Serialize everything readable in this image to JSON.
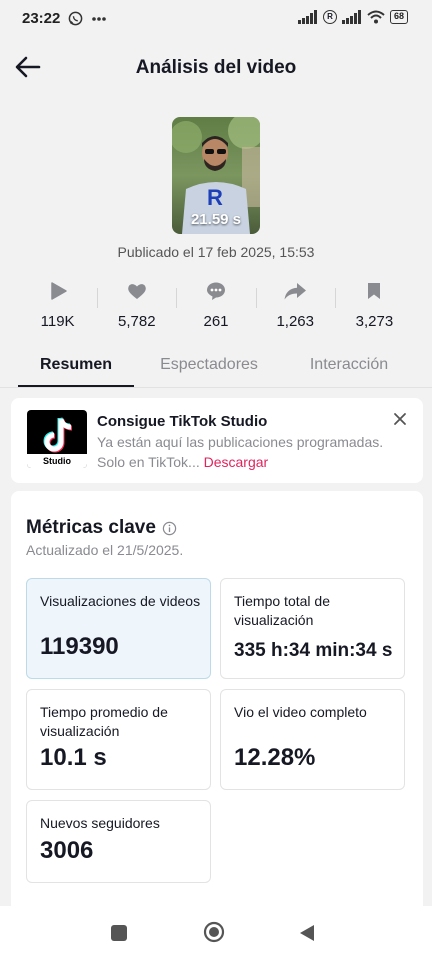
{
  "status_bar": {
    "time": "23:22",
    "battery": "68"
  },
  "header": {
    "title": "Análisis del video"
  },
  "video": {
    "duration": "21.59 s",
    "published": "Publicado el 17 feb 2025, 15:53"
  },
  "stats": [
    {
      "icon": "play-icon",
      "value": "119K"
    },
    {
      "icon": "heart-icon",
      "value": "5,782"
    },
    {
      "icon": "comment-icon",
      "value": "261"
    },
    {
      "icon": "share-icon",
      "value": "1,263"
    },
    {
      "icon": "bookmark-icon",
      "value": "3,273"
    }
  ],
  "tabs": {
    "resumen": "Resumen",
    "espectadores": "Espectadores",
    "interaccion": "Interacción",
    "active": "Resumen"
  },
  "promo": {
    "logo_label": "Studio",
    "title": "Consigue TikTok Studio",
    "description": "Ya están aquí las publicaciones programadas. Solo en TikTok...",
    "link": "Descargar"
  },
  "metrics": {
    "title": "Métricas clave",
    "updated": "Actualizado el 21/5/2025.",
    "cards": [
      {
        "label": "Visualizaciones de videos",
        "value": "119390"
      },
      {
        "label": "Tiempo total de visualización",
        "value": "335 h:34 min:34 s"
      },
      {
        "label": "Tiempo promedio de visualización",
        "value": "10.1 s"
      },
      {
        "label": "Vio el video completo",
        "value": "12.28%"
      },
      {
        "label": "Nuevos seguidores",
        "value": "3006"
      }
    ]
  },
  "colors": {
    "accent_link": "#e0245e",
    "selected_card_bg": "#eef6fb",
    "text_primary": "#161823",
    "text_secondary": "#8a8b91"
  }
}
